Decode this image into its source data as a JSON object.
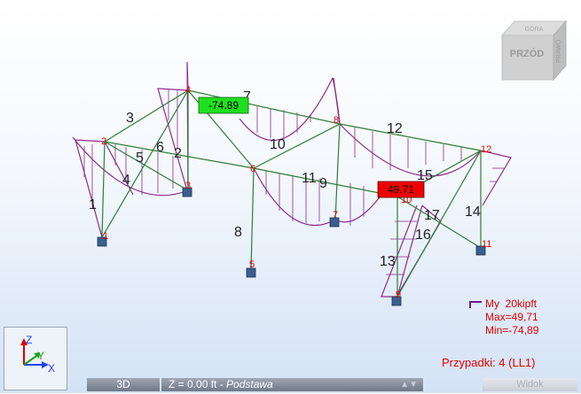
{
  "view": {
    "cube_labels": {
      "front": "PRZÓD",
      "side": "PRAWO",
      "top": "GÓRA"
    }
  },
  "member_labels": [
    "1",
    "2",
    "3",
    "4",
    "5",
    "6",
    "7",
    "8",
    "9",
    "10",
    "11",
    "12",
    "13",
    "14",
    "15",
    "16",
    "17"
  ],
  "node_labels": [
    "1",
    "2",
    "3",
    "4",
    "5",
    "6",
    "7",
    "8",
    "9",
    "10",
    "11",
    "12"
  ],
  "extremes": {
    "min_value": "-74.89",
    "max_value": "49.71"
  },
  "legend": {
    "quantity": "My",
    "scale": "20kipft",
    "max_text": "Max=49,71",
    "min_text": "Min=-74,89"
  },
  "load_case": "Przypadki: 4 (LL1)",
  "axes": {
    "x": "X",
    "y": "Y",
    "z": "Z"
  },
  "bottom_bar": {
    "mode_button": "3D",
    "level_text": "Z = 0.00 ft - ",
    "level_name": "Podstawa",
    "view_button": "Widok"
  },
  "colors": {
    "frame": "#2e7d32",
    "diagram": "#8e2a8e",
    "support": "#3a5f8f",
    "node_label": "#e00000",
    "min_box": "#1fe01f",
    "max_box": "#ee0000"
  }
}
